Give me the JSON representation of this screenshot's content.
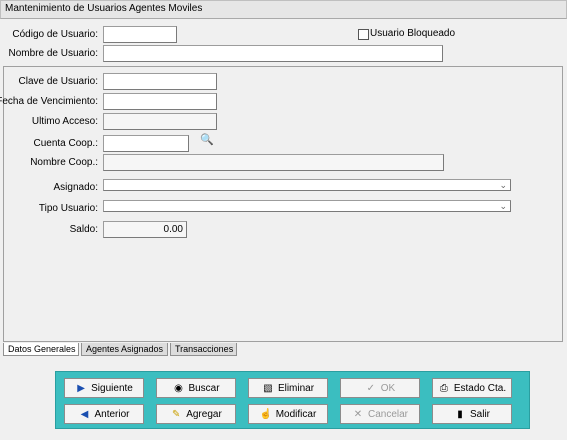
{
  "window": {
    "title": "Mantenimiento de Usuarios Agentes Moviles"
  },
  "header": {
    "codigo_label": "Código de Usuario:",
    "codigo_value": "",
    "bloqueado_label": "Usuario Bloqueado",
    "bloqueado_checked": false,
    "nombre_label": "Nombre de Usuario:",
    "nombre_value": ""
  },
  "form": {
    "clave_label": "Clave de Usuario:",
    "clave_value": "",
    "fecha_label": "Fecha de Vencimiento:",
    "fecha_value": "",
    "ultimo_label": "Ultimo Acceso:",
    "ultimo_value": "",
    "cuenta_label": "Cuenta Coop.:",
    "cuenta_value": "",
    "nombre_coop_label": "Nombre Coop.:",
    "nombre_coop_value": "",
    "asignado_label": "Asignado:",
    "asignado_value": "",
    "tipo_label": "Tipo Usuario:",
    "tipo_value": "",
    "saldo_label": "Saldo:",
    "saldo_value": "0.00"
  },
  "tabs": [
    {
      "label": "Datos Generales",
      "active": true
    },
    {
      "label": "Agentes Asignados",
      "active": false
    },
    {
      "label": "Transacciones",
      "active": false
    }
  ],
  "buttons": {
    "siguiente": {
      "label": "Siguiente",
      "icon": "triangle-right-icon"
    },
    "buscar": {
      "label": "Buscar",
      "icon": "binoculars-icon"
    },
    "eliminar": {
      "label": "Eliminar",
      "icon": "trash-icon"
    },
    "ok": {
      "label": "OK",
      "icon": "checkmark-icon",
      "disabled": true
    },
    "estado": {
      "label": "Estado Cta.",
      "icon": "printer-icon"
    },
    "anterior": {
      "label": "Anterior",
      "icon": "triangle-left-icon"
    },
    "agregar": {
      "label": "Agregar",
      "icon": "pencil-icon"
    },
    "modificar": {
      "label": "Modificar",
      "icon": "hand-edit-icon"
    },
    "cancelar": {
      "label": "Cancelar",
      "icon": "x-icon",
      "disabled": true
    },
    "salir": {
      "label": "Salir",
      "icon": "door-exit-icon"
    }
  }
}
